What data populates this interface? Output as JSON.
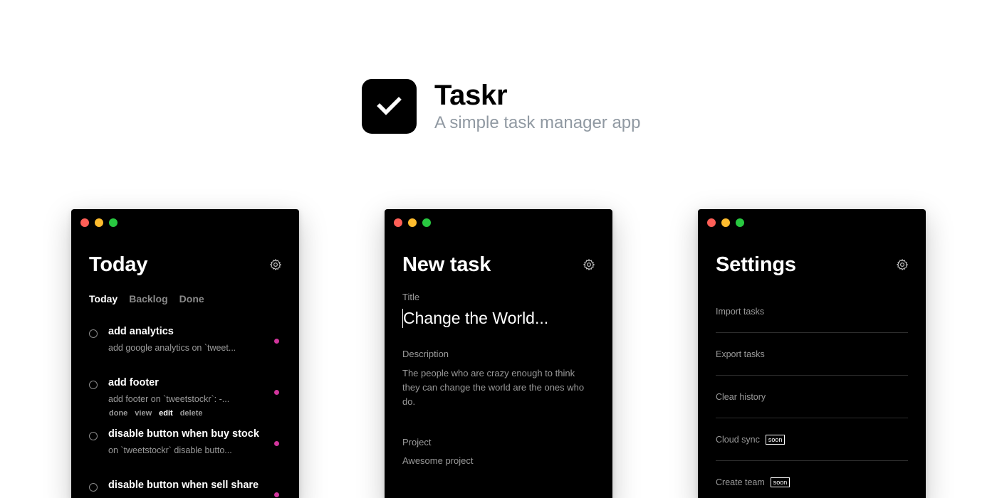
{
  "brand": {
    "name": "Taskr",
    "tagline": "A simple task manager app"
  },
  "windows": {
    "today": {
      "title": "Today",
      "tabs": [
        {
          "label": "Today",
          "active": true
        },
        {
          "label": "Backlog",
          "active": false
        },
        {
          "label": "Done",
          "active": false
        }
      ],
      "tasks": [
        {
          "title": "add analytics",
          "desc": "add google analytics on `tweet...",
          "dot_color": "#d1359c"
        },
        {
          "title": "add footer",
          "desc": "add footer on `tweetstockr`: -...",
          "dot_color": "#d1359c",
          "actions": [
            "done",
            "view",
            "edit",
            "delete"
          ]
        },
        {
          "title": "disable button when buy stock",
          "desc": "on `tweetstockr` disable butto...",
          "dot_color": "#d1359c"
        },
        {
          "title": "disable button when sell share",
          "desc": "",
          "dot_color": "#d1359c"
        }
      ]
    },
    "new_task": {
      "title": "New task",
      "title_label": "Title",
      "title_value": "Change the World...",
      "description_label": "Description",
      "description_value": "The people who are crazy enough to think they can change the world are the ones who do.",
      "project_label": "Project",
      "project_value": "Awesome project"
    },
    "settings": {
      "title": "Settings",
      "items": [
        {
          "label": "Import tasks",
          "badge": ""
        },
        {
          "label": "Export tasks",
          "badge": ""
        },
        {
          "label": "Clear history",
          "badge": ""
        },
        {
          "label": "Cloud sync",
          "badge": "soon"
        },
        {
          "label": "Create team",
          "badge": "soon"
        }
      ]
    }
  },
  "colors": {
    "window_bg": "#000000",
    "accent_dot": "#d1359c",
    "muted_text": "#9a9a9a",
    "tagline": "#9099a2"
  },
  "icons": [
    "checkmark-icon",
    "gear-icon"
  ]
}
